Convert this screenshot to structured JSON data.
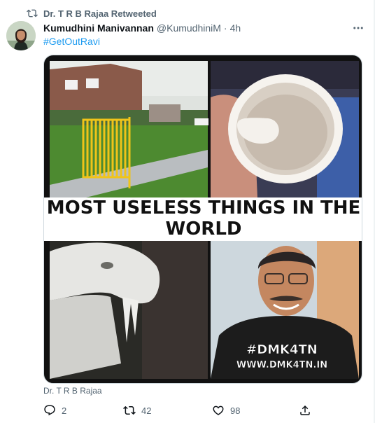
{
  "retweet_context": {
    "text": "Dr. T R B Rajaa Retweeted",
    "icon": "retweet-icon"
  },
  "tweet": {
    "author_name": "Kumudhini Manivannan",
    "author_handle": "@KumudhiniM",
    "separator": "·",
    "time": "4h",
    "hashtag": "#GetOutRavi",
    "more_icon": "more-icon"
  },
  "media": {
    "caption_line1": "MOST USELESS THINGS IN THE",
    "caption_line2": "WORLD",
    "watermark_tag": "#DMK4TN",
    "watermark_url": "WWW.DMK4TN.IN"
  },
  "footer": {
    "name": "Dr. T R B Rajaa"
  },
  "actions": {
    "reply_count": "2",
    "retweet_count": "42",
    "like_count": "98"
  },
  "colors": {
    "accent": "#1d9bf0",
    "muted": "#536471",
    "text": "#0f1419"
  }
}
